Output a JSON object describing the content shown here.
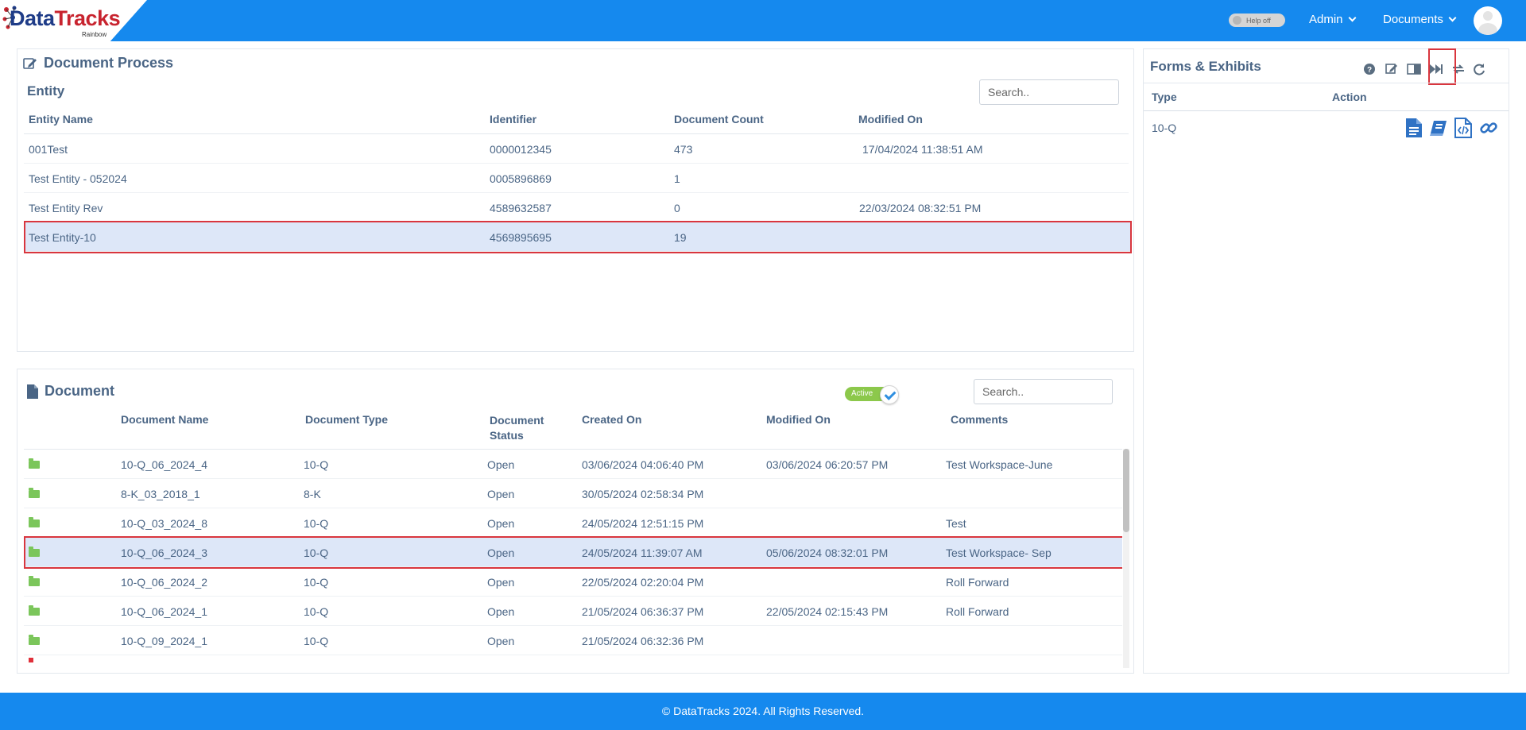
{
  "header": {
    "logo_text_1": "Data",
    "logo_text_2": "Tracks",
    "logo_sub": "Rainbow",
    "help_toggle": "Help off",
    "user_menu": "Admin",
    "documents_menu": "Documents",
    "brand_color": "#1589ee"
  },
  "document_process": {
    "title": "Document Process",
    "entity_heading": "Entity",
    "search_placeholder": "Search..",
    "columns": [
      "Entity Name",
      "Identifier",
      "Document Count",
      "Modified On"
    ],
    "rows": [
      {
        "name": "001Test",
        "identifier": "0000012345",
        "count": "473",
        "modified": "17/04/2024 11:38:51 AM"
      },
      {
        "name": "Test Entity - 052024",
        "identifier": "0005896869",
        "count": "1",
        "modified": ""
      },
      {
        "name": "Test Entity Rev",
        "identifier": "4589632587",
        "count": "0",
        "modified": "22/03/2024 08:32:51 PM"
      },
      {
        "name": "Test Entity-10",
        "identifier": "4569895695",
        "count": "19",
        "modified": ""
      }
    ],
    "selected_row": "Test Entity-10"
  },
  "document": {
    "title": "Document",
    "active_label": "Active",
    "search_placeholder": "Search..",
    "columns": [
      "Document Name",
      "Document Type",
      "Document Status",
      "Created On",
      "Modified On",
      "Comments"
    ],
    "column_status_line1": "Document",
    "column_status_line2": "Status",
    "rows": [
      {
        "name": "10-Q_06_2024_4",
        "type": "10-Q",
        "status": "Open",
        "created": "03/06/2024 04:06:40 PM",
        "modified": "03/06/2024 06:20:57 PM",
        "comments": "Test Workspace-June"
      },
      {
        "name": "8-K_03_2018_1",
        "type": "8-K",
        "status": "Open",
        "created": "30/05/2024 02:58:34 PM",
        "modified": "",
        "comments": ""
      },
      {
        "name": "10-Q_03_2024_8",
        "type": "10-Q",
        "status": "Open",
        "created": "24/05/2024 12:51:15 PM",
        "modified": "",
        "comments": "Test"
      },
      {
        "name": "10-Q_06_2024_3",
        "type": "10-Q",
        "status": "Open",
        "created": "24/05/2024 11:39:07 AM",
        "modified": "05/06/2024 08:32:01 PM",
        "comments": "Test Workspace- Sep"
      },
      {
        "name": "10-Q_06_2024_2",
        "type": "10-Q",
        "status": "Open",
        "created": "22/05/2024 02:20:04 PM",
        "modified": "",
        "comments": "Roll Forward"
      },
      {
        "name": "10-Q_06_2024_1",
        "type": "10-Q",
        "status": "Open",
        "created": "21/05/2024 06:36:37 PM",
        "modified": "22/05/2024 02:15:43 PM",
        "comments": "Roll Forward"
      },
      {
        "name": "10-Q_09_2024_1",
        "type": "10-Q",
        "status": "Open",
        "created": "21/05/2024 06:32:36 PM",
        "modified": "",
        "comments": ""
      }
    ],
    "selected_row": "10-Q_06_2024_3"
  },
  "forms_exhibits": {
    "title": "Forms & Exhibits",
    "columns": [
      "Type",
      "Action"
    ],
    "rows": [
      {
        "type": "10-Q"
      }
    ],
    "toolbar_icons": [
      "help-icon",
      "edit-icon",
      "panel-icon",
      "fast-forward-icon",
      "transfer-icon",
      "refresh-icon"
    ],
    "action_icons": [
      "document-icon",
      "book-icon",
      "code-file-icon",
      "link-icon"
    ]
  },
  "footer": {
    "text": "© DataTracks 2024. All Rights Reserved."
  }
}
